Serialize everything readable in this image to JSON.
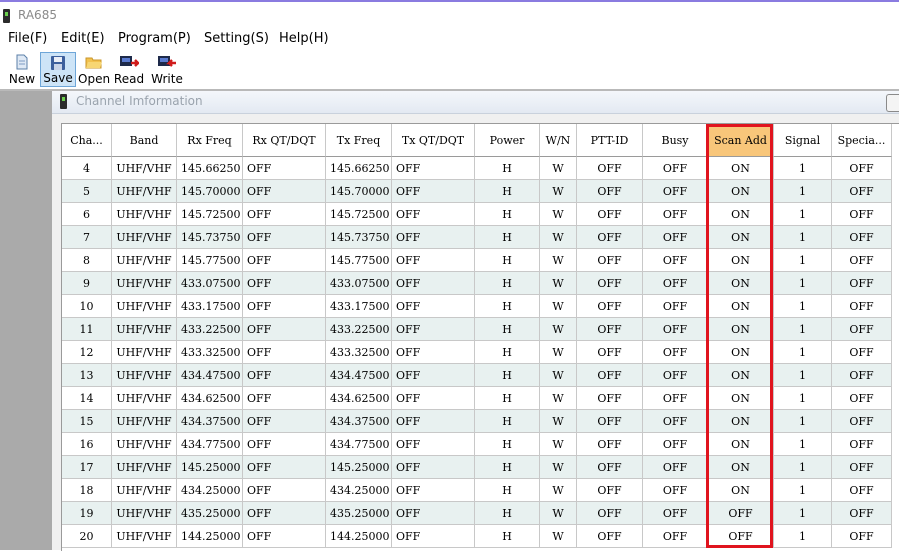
{
  "window": {
    "title": "RA685"
  },
  "menu": [
    "File(F)",
    "Edit(E)",
    "Program(P)",
    "Setting(S)",
    "Help(H)"
  ],
  "toolbar": {
    "new": "New",
    "save": "Save",
    "open": "Open",
    "read": "Read",
    "write": "Write"
  },
  "panel": {
    "title": "Channel Imformation"
  },
  "table": {
    "headers": [
      "Cha...",
      "Band",
      "Rx Freq",
      "Rx QT/DQT",
      "Tx Freq",
      "Tx QT/DQT",
      "Power",
      "W/N",
      "PTT-ID",
      "Busy",
      "Scan Add",
      "Signal",
      "Specia..."
    ],
    "selected_header": "Scan Add",
    "rows": [
      [
        "4",
        "UHF/VHF",
        "145.66250",
        "OFF",
        "145.66250",
        "OFF",
        "H",
        "W",
        "OFF",
        "OFF",
        "ON",
        "1",
        "OFF"
      ],
      [
        "5",
        "UHF/VHF",
        "145.70000",
        "OFF",
        "145.70000",
        "OFF",
        "H",
        "W",
        "OFF",
        "OFF",
        "ON",
        "1",
        "OFF"
      ],
      [
        "6",
        "UHF/VHF",
        "145.72500",
        "OFF",
        "145.72500",
        "OFF",
        "H",
        "W",
        "OFF",
        "OFF",
        "ON",
        "1",
        "OFF"
      ],
      [
        "7",
        "UHF/VHF",
        "145.73750",
        "OFF",
        "145.73750",
        "OFF",
        "H",
        "W",
        "OFF",
        "OFF",
        "ON",
        "1",
        "OFF"
      ],
      [
        "8",
        "UHF/VHF",
        "145.77500",
        "OFF",
        "145.77500",
        "OFF",
        "H",
        "W",
        "OFF",
        "OFF",
        "ON",
        "1",
        "OFF"
      ],
      [
        "9",
        "UHF/VHF",
        "433.07500",
        "OFF",
        "433.07500",
        "OFF",
        "H",
        "W",
        "OFF",
        "OFF",
        "ON",
        "1",
        "OFF"
      ],
      [
        "10",
        "UHF/VHF",
        "433.17500",
        "OFF",
        "433.17500",
        "OFF",
        "H",
        "W",
        "OFF",
        "OFF",
        "ON",
        "1",
        "OFF"
      ],
      [
        "11",
        "UHF/VHF",
        "433.22500",
        "OFF",
        "433.22500",
        "OFF",
        "H",
        "W",
        "OFF",
        "OFF",
        "ON",
        "1",
        "OFF"
      ],
      [
        "12",
        "UHF/VHF",
        "433.32500",
        "OFF",
        "433.32500",
        "OFF",
        "H",
        "W",
        "OFF",
        "OFF",
        "ON",
        "1",
        "OFF"
      ],
      [
        "13",
        "UHF/VHF",
        "434.47500",
        "OFF",
        "434.47500",
        "OFF",
        "H",
        "W",
        "OFF",
        "OFF",
        "ON",
        "1",
        "OFF"
      ],
      [
        "14",
        "UHF/VHF",
        "434.62500",
        "OFF",
        "434.62500",
        "OFF",
        "H",
        "W",
        "OFF",
        "OFF",
        "ON",
        "1",
        "OFF"
      ],
      [
        "15",
        "UHF/VHF",
        "434.37500",
        "OFF",
        "434.37500",
        "OFF",
        "H",
        "W",
        "OFF",
        "OFF",
        "ON",
        "1",
        "OFF"
      ],
      [
        "16",
        "UHF/VHF",
        "434.77500",
        "OFF",
        "434.77500",
        "OFF",
        "H",
        "W",
        "OFF",
        "OFF",
        "ON",
        "1",
        "OFF"
      ],
      [
        "17",
        "UHF/VHF",
        "145.25000",
        "OFF",
        "145.25000",
        "OFF",
        "H",
        "W",
        "OFF",
        "OFF",
        "ON",
        "1",
        "OFF"
      ],
      [
        "18",
        "UHF/VHF",
        "434.25000",
        "OFF",
        "434.25000",
        "OFF",
        "H",
        "W",
        "OFF",
        "OFF",
        "ON",
        "1",
        "OFF"
      ],
      [
        "19",
        "UHF/VHF",
        "435.25000",
        "OFF",
        "435.25000",
        "OFF",
        "H",
        "W",
        "OFF",
        "OFF",
        "OFF",
        "1",
        "OFF"
      ],
      [
        "20",
        "UHF/VHF",
        "144.25000",
        "OFF",
        "144.25000",
        "OFF",
        "H",
        "W",
        "OFF",
        "OFF",
        "OFF",
        "1",
        "OFF"
      ]
    ]
  },
  "colors": {
    "highlight_box": "#e0141e",
    "selected_header_bg": "#f8c67a",
    "alt_row_bg": "#e8f1f0"
  },
  "icons": {
    "app": "radio-icon",
    "new": "new-document-icon",
    "save": "save-disk-icon",
    "open": "open-folder-icon",
    "read": "read-from-radio-icon",
    "write": "write-to-radio-icon"
  }
}
